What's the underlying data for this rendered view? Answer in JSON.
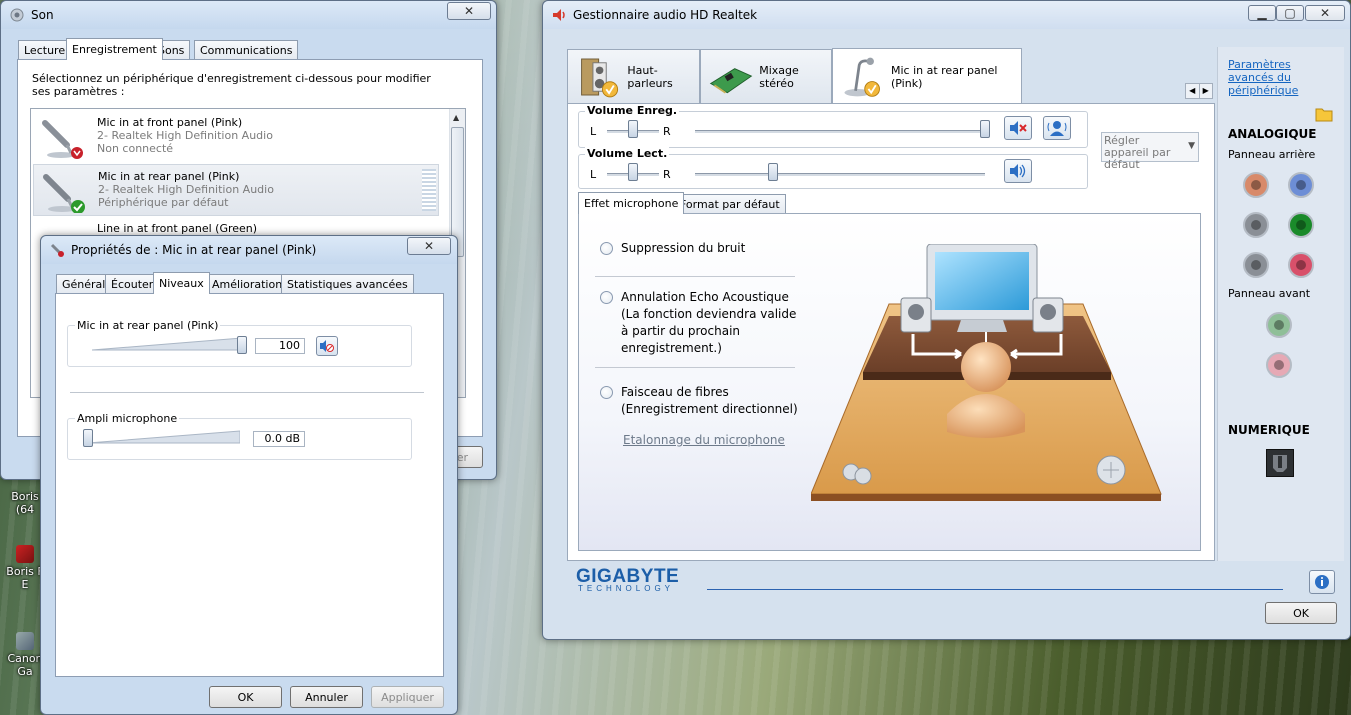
{
  "desktop": {
    "icons": [
      {
        "label": "Boris (64"
      },
      {
        "label": "Boris F E"
      },
      {
        "label": "Canon Ga"
      }
    ]
  },
  "son": {
    "title": "Son",
    "tabs": [
      "Lecture",
      "Enregistrement",
      "Sons",
      "Communications"
    ],
    "active_tab": "Enregistrement",
    "instruction": "Sélectionnez un périphérique d'enregistrement ci-dessous pour modifier ses paramètres :",
    "devices": [
      {
        "name": "Mic in at front panel (Pink)",
        "driver": "2- Realtek High Definition Audio",
        "status": "Non connecté"
      },
      {
        "name": "Mic in at rear panel (Pink)",
        "driver": "2- Realtek High Definition Audio",
        "status": "Périphérique par défaut"
      },
      {
        "name": "Line in at front panel (Green)"
      }
    ],
    "partial_button": "er"
  },
  "props": {
    "title": "Propriétés de : Mic in at rear panel (Pink)",
    "tabs": [
      "Général",
      "Écouter",
      "Niveaux",
      "Améliorations",
      "Statistiques avancées"
    ],
    "active_tab": "Niveaux",
    "level": {
      "label": "Mic in at rear panel (Pink)",
      "value": "100",
      "fraction": 1.0
    },
    "boost": {
      "label": "Ampli microphone",
      "value": "0.0 dB",
      "fraction": 0.0
    },
    "buttons": {
      "ok": "OK",
      "cancel": "Annuler",
      "apply": "Appliquer"
    }
  },
  "realtek": {
    "title": "Gestionnaire audio HD Realtek",
    "tabs": [
      "Haut-parleurs",
      "Mixage stéréo",
      "Mic in at rear panel (Pink)"
    ],
    "active_tab": "Mic in at rear panel (Pink)",
    "rec_volume": {
      "label": "Volume Enreg.",
      "left": "L",
      "right": "R",
      "balance": 0.5,
      "level": 1.0
    },
    "play_volume": {
      "label": "Volume Lect.",
      "left": "L",
      "right": "R",
      "balance": 0.5,
      "level": 0.27
    },
    "default_device": "Régler appareil par défaut",
    "subtabs": [
      "Effet microphone",
      "Format par défaut"
    ],
    "active_subtab": "Effet microphone",
    "options": [
      {
        "label": "Suppression du bruit"
      },
      {
        "label": "Annulation Echo Acoustique (La fonction deviendra valide à partir du prochain enregistrement.)"
      },
      {
        "label": "Faisceau de fibres (Enregistrement directionnel)"
      }
    ],
    "calibration_link": "Etalonnage du microphone",
    "side": {
      "advanced_link": "Paramètres avancés du périphérique",
      "analog": "ANALOGIQUE",
      "rear_panel": "Panneau arrière",
      "front_panel": "Panneau avant",
      "digital": "NUMERIQUE"
    },
    "brand": "GIGABYTE",
    "brand_sub": "TECHNOLOGY",
    "ok": "OK",
    "colors": {
      "jack_orange": "#d88a6a",
      "jack_blue": "#6d8ed6",
      "jack_gray": "#8a8f96",
      "jack_green": "#1a8a2a",
      "jack_pink": "#d8506a",
      "jack_front_green": "#8fbf98",
      "jack_front_pink": "#e6a9b5",
      "link": "#1565c0"
    }
  }
}
